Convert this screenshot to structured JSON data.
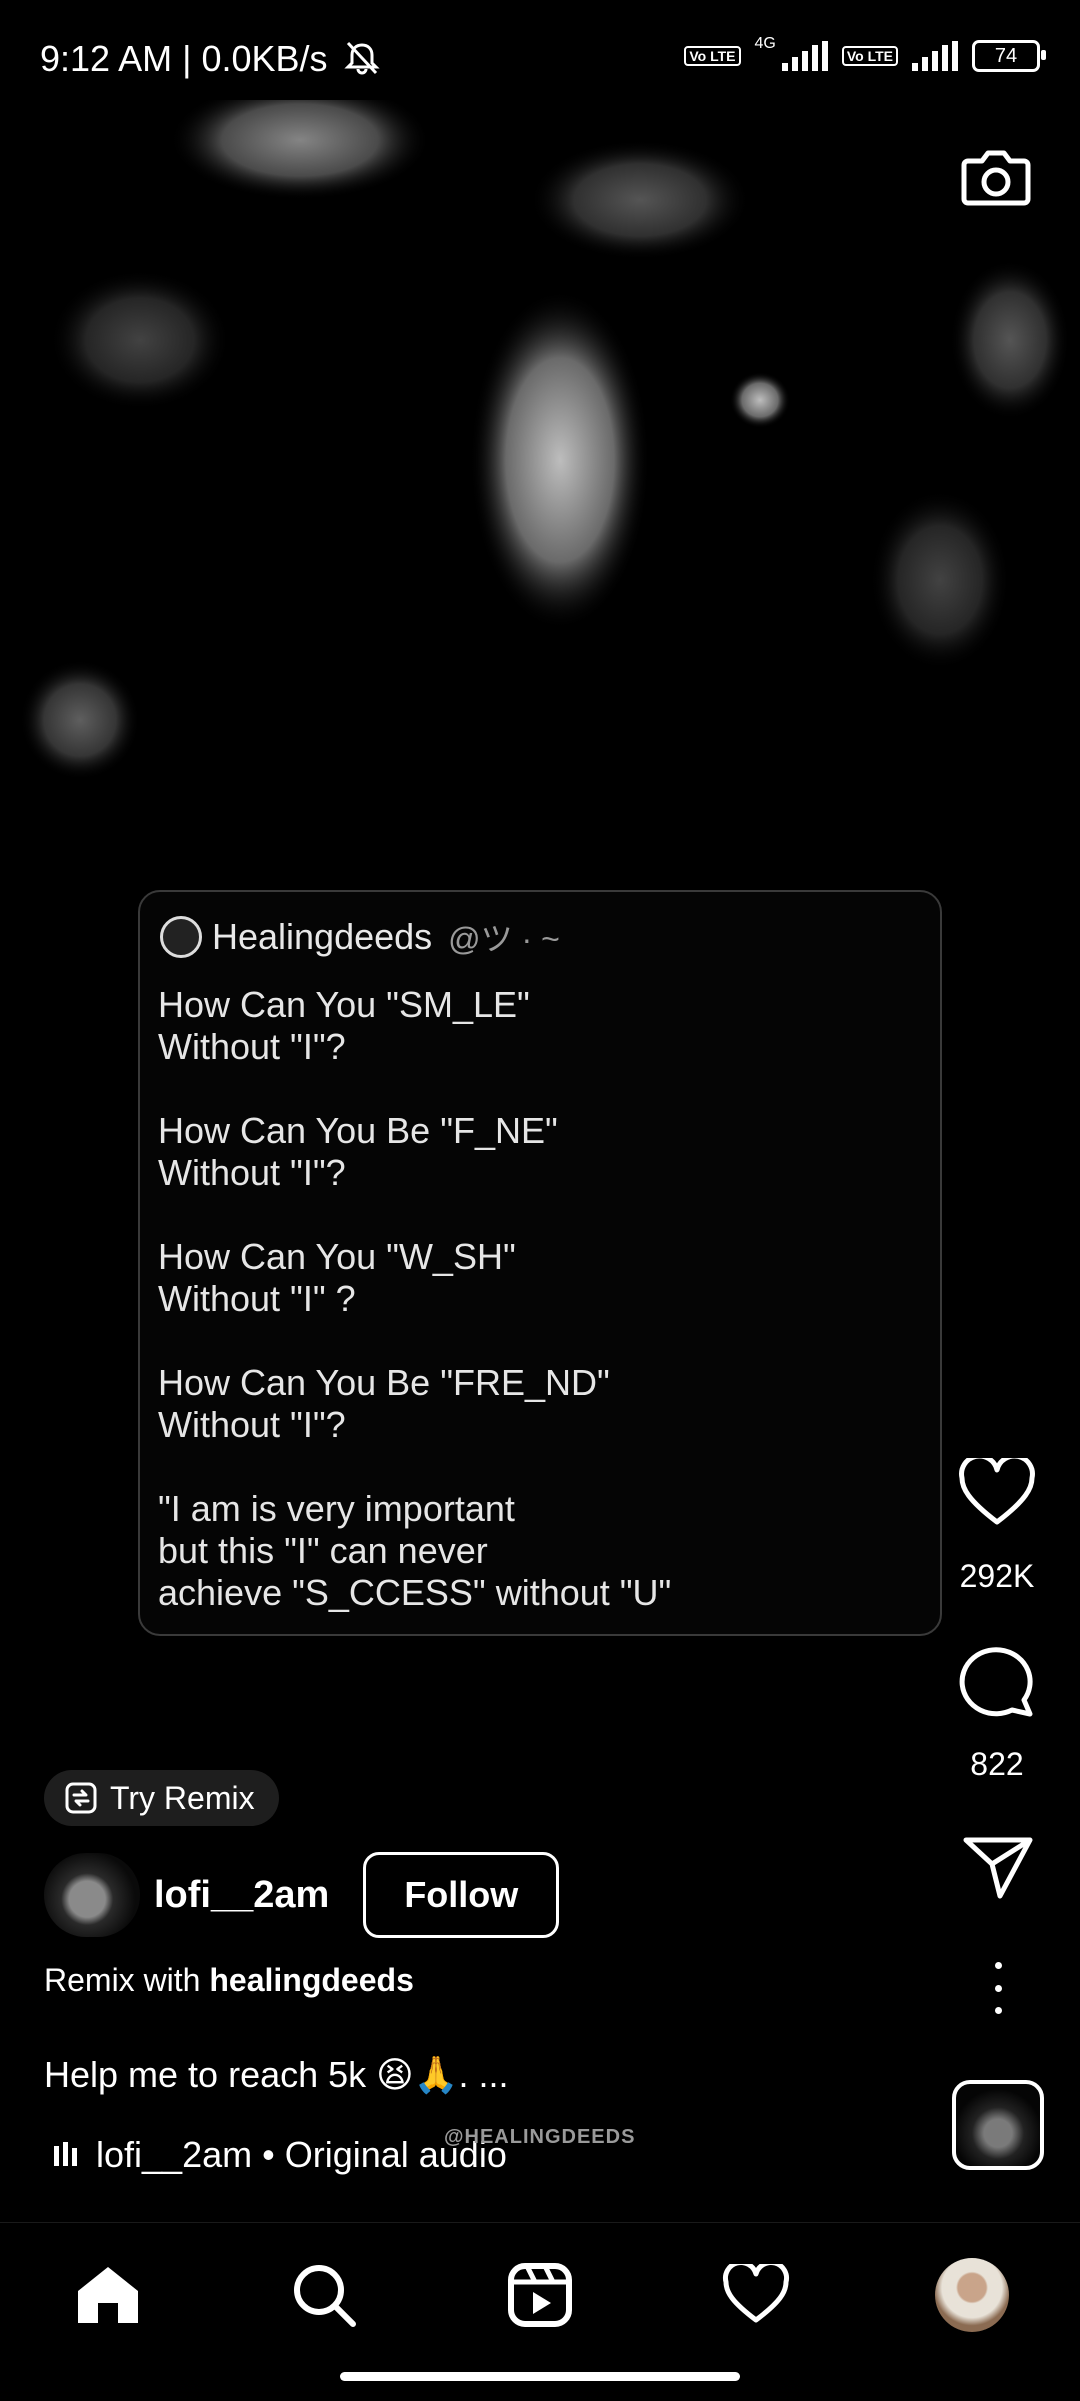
{
  "status_bar": {
    "time": "9:12 AM | 0.0KB/s",
    "network_type": "4G",
    "volte_label_1": "Vo LTE",
    "volte_label_2": "Vo LTE",
    "battery": "74"
  },
  "tweet": {
    "name": "Healingdeeds",
    "handle": "@ツ · ~",
    "lines": [
      "How Can You \"SM_LE\"",
      "Without \"I\"?",
      "",
      "How Can You Be \"F_NE\"",
      "Without \"I\"?",
      "",
      "How Can You \"W_SH\"",
      "Without \"I\" ?",
      "",
      "How Can You Be \"FRE_ND\"",
      "Without \"I\"?",
      "",
      "\"I am is very important",
      "but this \"I\" can never",
      "achieve \"S_CCESS\" without \"U\""
    ]
  },
  "actions": {
    "like_count": "292K",
    "comment_count": "822"
  },
  "reel": {
    "try_remix_label": "Try Remix",
    "author": "lofi__2am",
    "follow_label": "Follow",
    "remix_prefix": "Remix with",
    "remix_user": "healingdeeds",
    "caption": "Help me to reach 5k 😫🙏. ...",
    "audio": "lofi__2am • Original audio",
    "watermark": "@HEALINGDEEDS"
  },
  "icons": {
    "camera": "camera-icon",
    "like": "heart-icon",
    "comment": "comment-icon",
    "share": "send-icon",
    "more": "more-icon",
    "home": "home-icon",
    "search": "search-icon",
    "reels": "reels-icon",
    "activity": "heart-icon",
    "profile": "profile-avatar"
  },
  "colors": {
    "background": "#000000",
    "text": "#ffffff",
    "pill": "#1e1e1e"
  }
}
